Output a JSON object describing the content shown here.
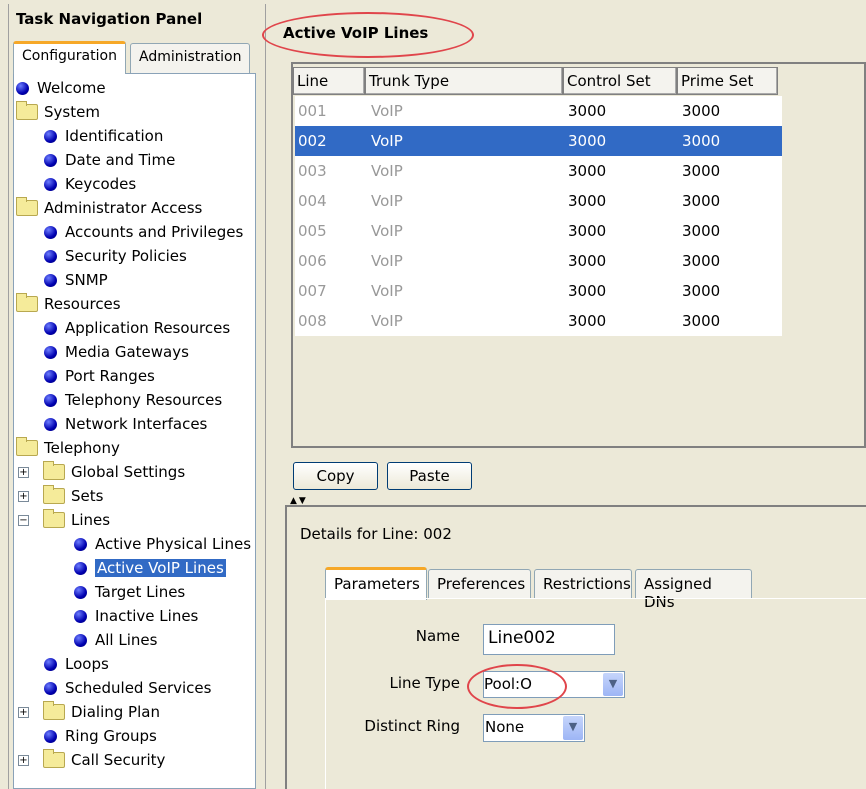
{
  "nav": {
    "title": "Task Navigation Panel",
    "tabs": [
      "Configuration",
      "Administration"
    ],
    "tree": [
      {
        "label": "Welcome",
        "type": "bullet",
        "level": 0
      },
      {
        "label": "System",
        "type": "folder",
        "level": 0
      },
      {
        "label": "Identification",
        "type": "bullet",
        "level": 1
      },
      {
        "label": "Date and Time",
        "type": "bullet",
        "level": 1
      },
      {
        "label": "Keycodes",
        "type": "bullet",
        "level": 1
      },
      {
        "label": "Administrator Access",
        "type": "folder",
        "level": 0
      },
      {
        "label": "Accounts and Privileges",
        "type": "bullet",
        "level": 1
      },
      {
        "label": "Security Policies",
        "type": "bullet",
        "level": 1
      },
      {
        "label": "SNMP",
        "type": "bullet",
        "level": 1
      },
      {
        "label": "Resources",
        "type": "folder",
        "level": 0
      },
      {
        "label": "Application Resources",
        "type": "bullet",
        "level": 1
      },
      {
        "label": "Media Gateways",
        "type": "bullet",
        "level": 1
      },
      {
        "label": "Port Ranges",
        "type": "bullet",
        "level": 1
      },
      {
        "label": "Telephony Resources",
        "type": "bullet",
        "level": 1
      },
      {
        "label": "Network Interfaces",
        "type": "bullet",
        "level": 1
      },
      {
        "label": "Telephony",
        "type": "folder",
        "level": 0
      },
      {
        "label": "Global Settings",
        "type": "folder",
        "level": 1,
        "expander": "+"
      },
      {
        "label": "Sets",
        "type": "folder",
        "level": 1,
        "expander": "+"
      },
      {
        "label": "Lines",
        "type": "folder",
        "level": 1,
        "expander": "-"
      },
      {
        "label": "Active Physical Lines",
        "type": "bullet",
        "level": 2
      },
      {
        "label": "Active VoIP Lines",
        "type": "bullet",
        "level": 2,
        "selected": true
      },
      {
        "label": "Target Lines",
        "type": "bullet",
        "level": 2
      },
      {
        "label": "Inactive Lines",
        "type": "bullet",
        "level": 2
      },
      {
        "label": "All Lines",
        "type": "bullet",
        "level": 2
      },
      {
        "label": "Loops",
        "type": "bullet",
        "level": 1
      },
      {
        "label": "Scheduled Services",
        "type": "bullet",
        "level": 1
      },
      {
        "label": "Dialing Plan",
        "type": "folder",
        "level": 1,
        "expander": "+"
      },
      {
        "label": "Ring Groups",
        "type": "bullet",
        "level": 1
      },
      {
        "label": "Call Security",
        "type": "folder",
        "level": 1,
        "expander": "+"
      }
    ]
  },
  "main": {
    "title": "Active VoIP Lines",
    "columns": [
      "Line",
      "Trunk Type",
      "Control Set",
      "Prime Set"
    ],
    "rows": [
      [
        "001",
        "VoIP",
        "3000",
        "3000"
      ],
      [
        "002",
        "VoIP",
        "3000",
        "3000"
      ],
      [
        "003",
        "VoIP",
        "3000",
        "3000"
      ],
      [
        "004",
        "VoIP",
        "3000",
        "3000"
      ],
      [
        "005",
        "VoIP",
        "3000",
        "3000"
      ],
      [
        "006",
        "VoIP",
        "3000",
        "3000"
      ],
      [
        "007",
        "VoIP",
        "3000",
        "3000"
      ],
      [
        "008",
        "VoIP",
        "3000",
        "3000"
      ]
    ],
    "selected_row": 1,
    "copy_label": "Copy",
    "paste_label": "Paste"
  },
  "details": {
    "title": "Details for Line: 002",
    "tabs": [
      "Parameters",
      "Preferences",
      "Restrictions",
      "Assigned DNs"
    ],
    "name_label": "Name",
    "name_value": "Line002",
    "line_type_label": "Line Type",
    "line_type_value": "Pool:O",
    "distinct_ring_label": "Distinct Ring",
    "distinct_ring_value": "None"
  },
  "colors": {
    "selection": "#316ac5",
    "annotation": "#e0454b",
    "tab_accent": "#f6a828"
  }
}
